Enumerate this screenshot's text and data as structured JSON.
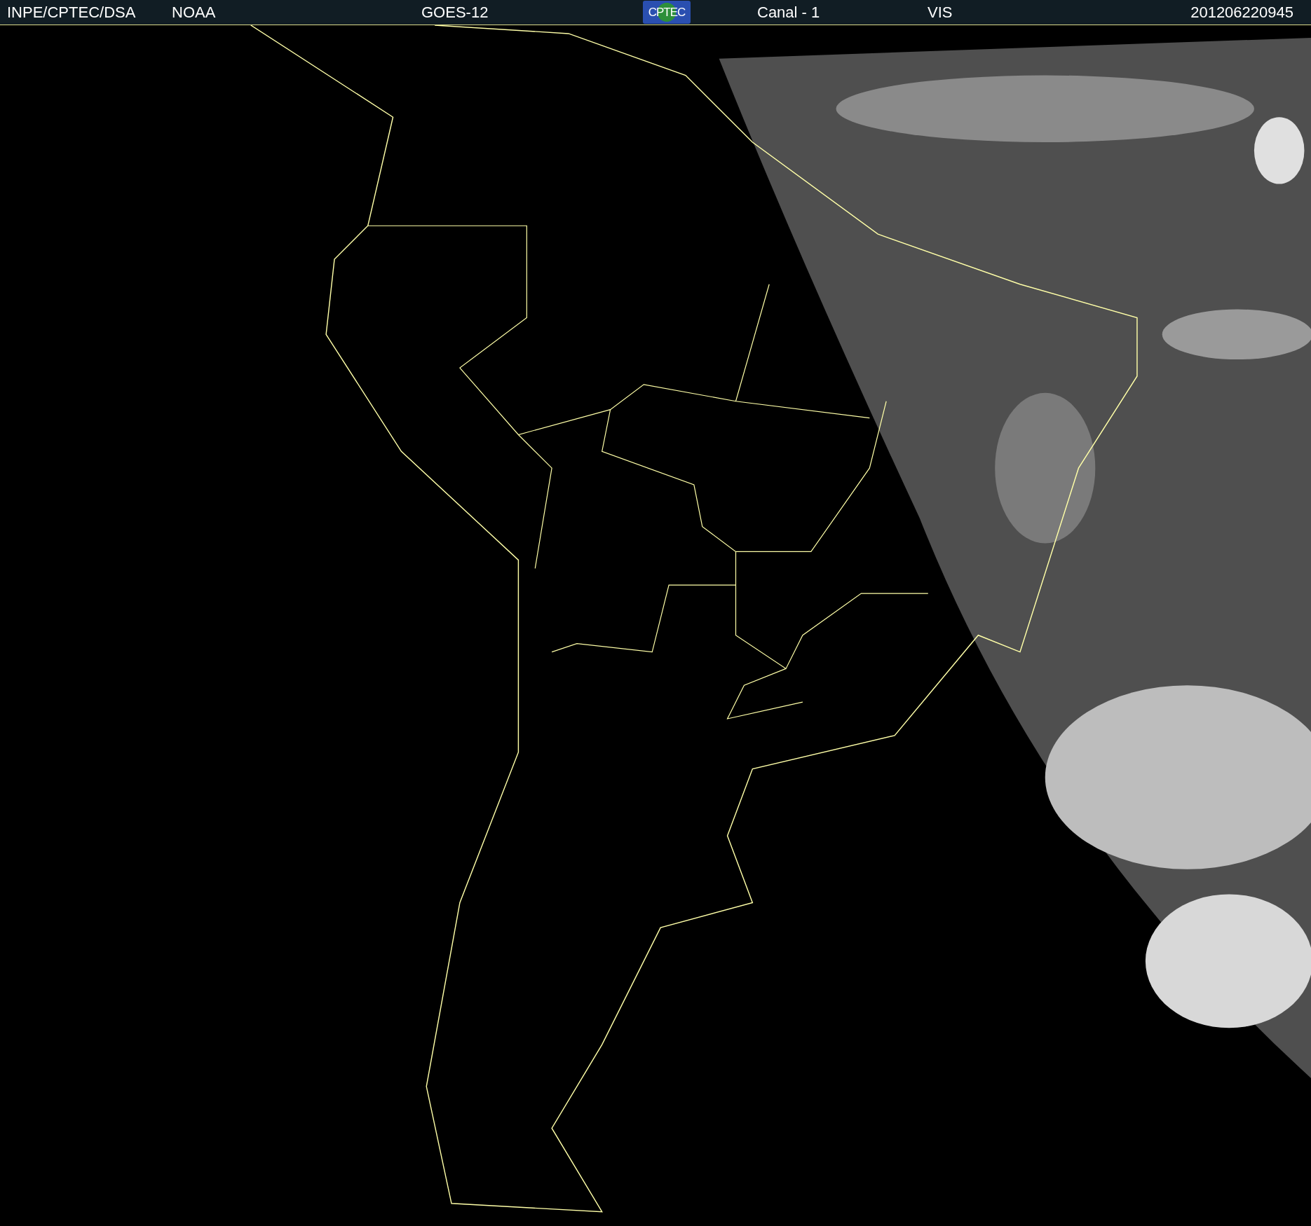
{
  "header": {
    "items": [
      {
        "kind": "text",
        "text": "INPE/CPTEC/DSA"
      },
      {
        "kind": "text",
        "text": "NOAA"
      },
      {
        "kind": "text",
        "text": "GOES-12"
      },
      {
        "kind": "logo",
        "text": "CPTEC"
      },
      {
        "kind": "text",
        "text": "Canal - 1"
      },
      {
        "kind": "text",
        "text": "VIS"
      },
      {
        "kind": "text",
        "text": "201206220945"
      }
    ]
  }
}
